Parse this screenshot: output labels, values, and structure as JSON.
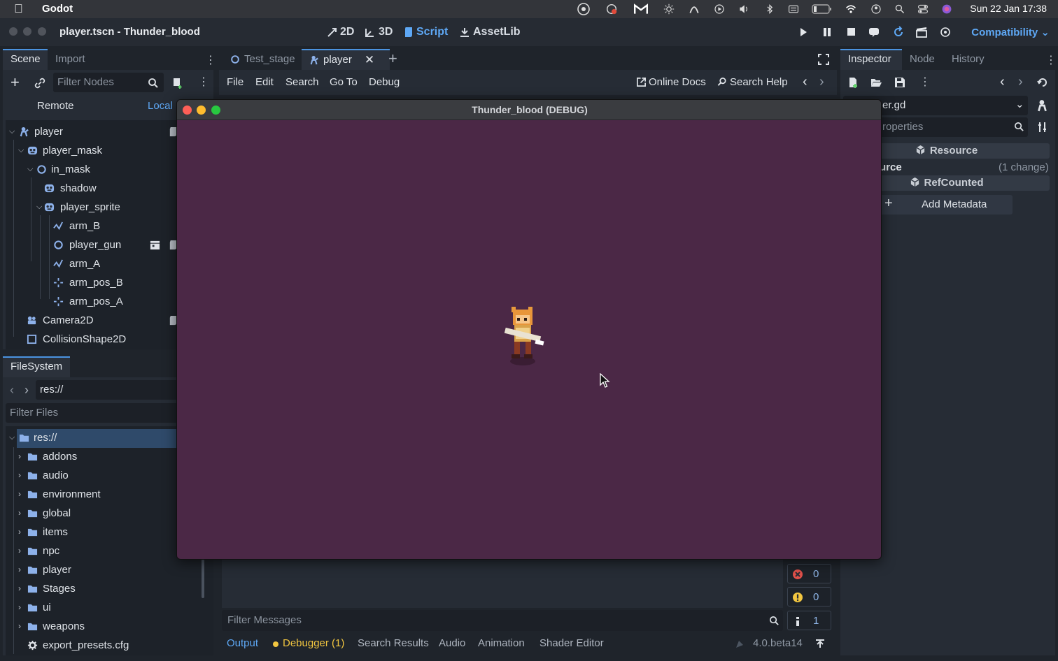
{
  "menubar": {
    "app_name": "Godot",
    "clock": "Sun 22 Jan  17:38"
  },
  "titlebar": {
    "window_title": "player.tscn - Thunder_blood",
    "workspaces": [
      "2D",
      "3D",
      "Script",
      "AssetLib"
    ],
    "active_workspace": "Script",
    "renderer": "Compatibility"
  },
  "scene_dock": {
    "tabs": [
      "Scene",
      "Import"
    ],
    "filter_placeholder": "Filter Nodes",
    "remote": "Remote",
    "local": "Local",
    "nodes": [
      {
        "name": "player",
        "depth": 0,
        "icon": "character-body-icon",
        "expanded": true,
        "script": true
      },
      {
        "name": "player_mask",
        "depth": 1,
        "icon": "sprite-icon",
        "expanded": true
      },
      {
        "name": "in_mask",
        "depth": 2,
        "icon": "node2d-icon",
        "expanded": true
      },
      {
        "name": "shadow",
        "depth": 3,
        "icon": "sprite-icon"
      },
      {
        "name": "player_sprite",
        "depth": 3,
        "icon": "sprite-icon",
        "expanded": true
      },
      {
        "name": "arm_B",
        "depth": 4,
        "icon": "line-icon"
      },
      {
        "name": "player_gun",
        "depth": 4,
        "icon": "node2d-icon",
        "script": true,
        "clapper": true
      },
      {
        "name": "arm_A",
        "depth": 4,
        "icon": "line-icon"
      },
      {
        "name": "arm_pos_B",
        "depth": 4,
        "icon": "marker-icon"
      },
      {
        "name": "arm_pos_A",
        "depth": 4,
        "icon": "marker-icon"
      },
      {
        "name": "Camera2D",
        "depth": 1,
        "icon": "camera-icon",
        "script": true
      },
      {
        "name": "CollisionShape2D",
        "depth": 1,
        "icon": "collision-icon"
      }
    ]
  },
  "filesystem_dock": {
    "tab": "FileSystem",
    "path": "res://",
    "filter_placeholder": "Filter Files",
    "items": [
      {
        "name": "res://",
        "type": "root"
      },
      {
        "name": "addons",
        "type": "folder"
      },
      {
        "name": "audio",
        "type": "folder"
      },
      {
        "name": "environment",
        "type": "folder"
      },
      {
        "name": "global",
        "type": "folder"
      },
      {
        "name": "items",
        "type": "folder"
      },
      {
        "name": "npc",
        "type": "folder"
      },
      {
        "name": "player",
        "type": "folder"
      },
      {
        "name": "Stages",
        "type": "folder"
      },
      {
        "name": "ui",
        "type": "folder"
      },
      {
        "name": "weapons",
        "type": "folder"
      },
      {
        "name": "export_presets.cfg",
        "type": "file"
      }
    ]
  },
  "editor": {
    "tabs": [
      {
        "name": "Test_stage",
        "icon": "node2d-icon"
      },
      {
        "name": "player",
        "icon": "character-body-icon"
      }
    ],
    "active_tab": "player",
    "menu": [
      "File",
      "Edit",
      "Search",
      "Go To",
      "Debug"
    ],
    "online_docs": "Online Docs",
    "search_help": "Search Help"
  },
  "game_window": {
    "title": "Thunder_blood (DEBUG)",
    "background": "#4b2846"
  },
  "inspector": {
    "tabs": [
      "Inspector",
      "Node",
      "History"
    ],
    "resource_field": "er.gd",
    "filter_placeholder": "roperties",
    "section_resource": "Resource",
    "prop_name": "urce",
    "prop_value": "(1 change)",
    "section_refcounted": "RefCounted",
    "add_metadata": "Add Metadata"
  },
  "bottom_panel": {
    "filter_placeholder": "Filter Messages",
    "errors": "0",
    "warnings": "0",
    "messages": "1",
    "tabs": [
      "Output",
      "Debugger (1)",
      "Search Results",
      "Audio",
      "Animation",
      "Shader Editor"
    ],
    "version": "4.0.beta14"
  }
}
